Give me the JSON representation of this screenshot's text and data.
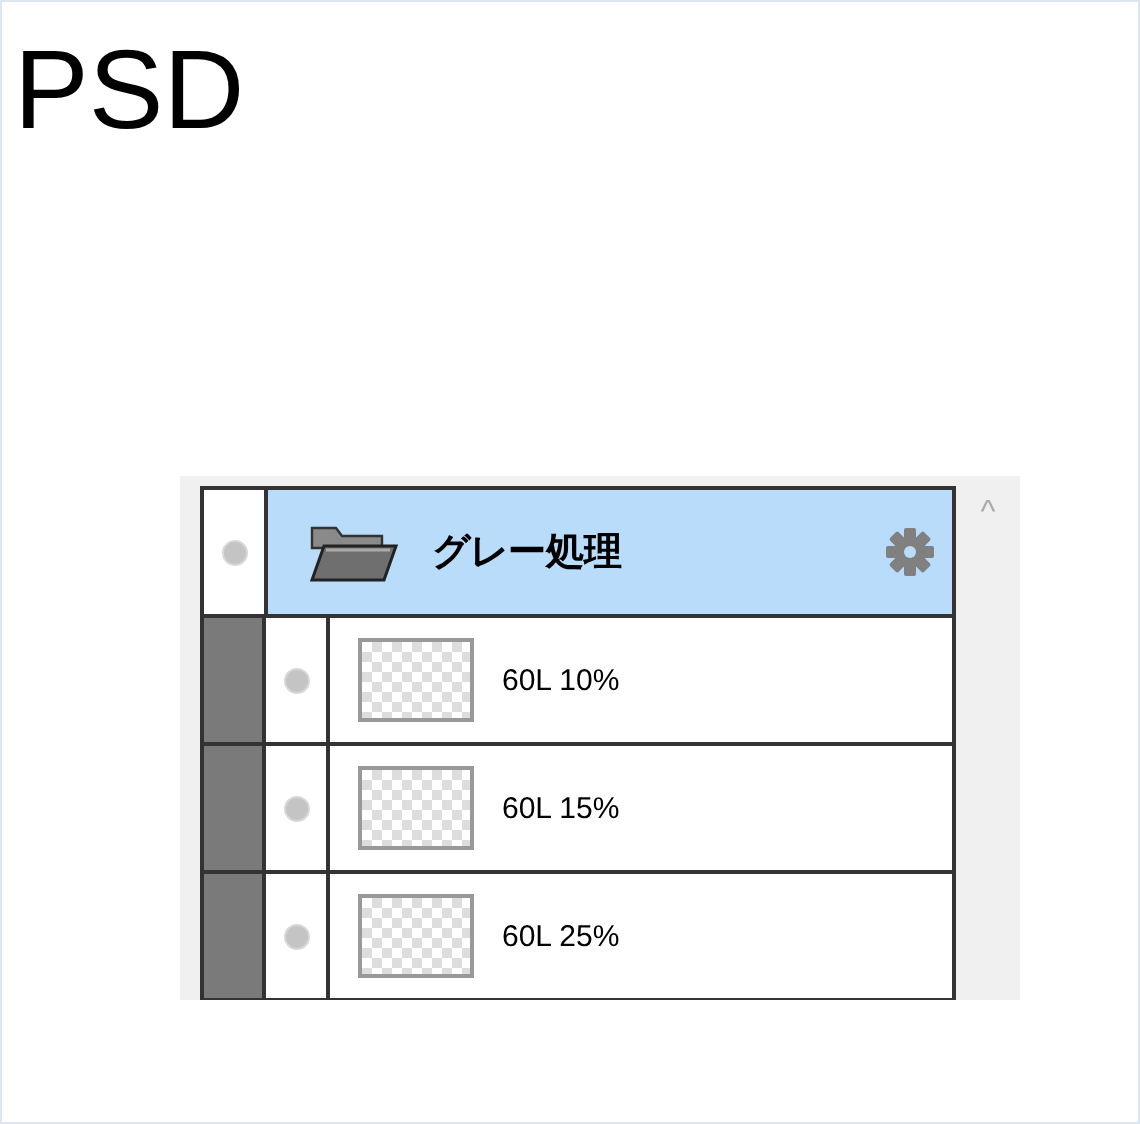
{
  "title": "PSD",
  "layers_panel": {
    "group": {
      "name": "グレー処理",
      "selected": true,
      "expanded": true,
      "children": [
        {
          "name": "60L 10%",
          "selected": false
        },
        {
          "name": "60L 15%",
          "selected": false
        },
        {
          "name": "60L 25%",
          "selected": false
        }
      ]
    },
    "scroll_up": "^"
  }
}
